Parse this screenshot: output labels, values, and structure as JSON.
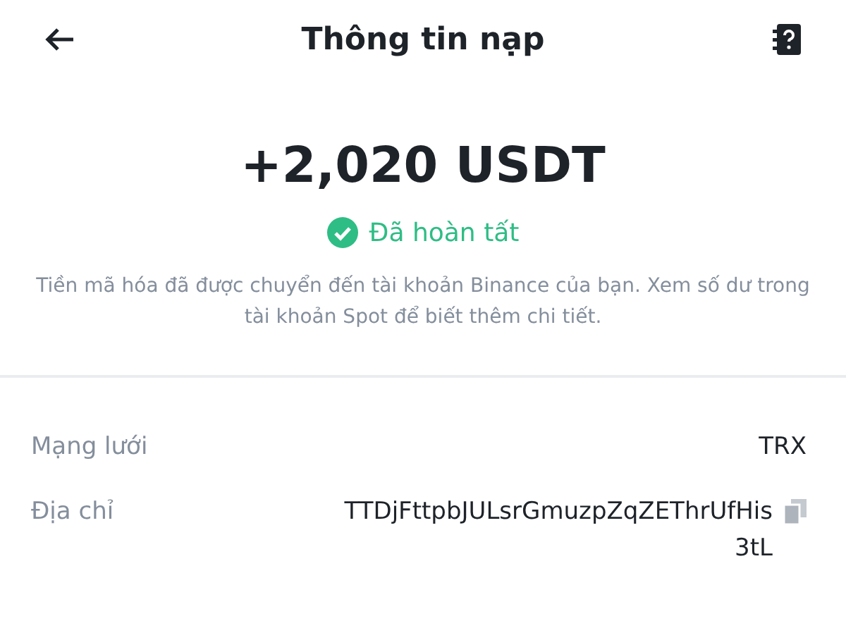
{
  "header": {
    "title": "Thông tin nạp"
  },
  "amount": "+2,020 USDT",
  "status": {
    "label": "Đã hoàn tất",
    "color": "#2ebd85"
  },
  "description": "Tiền mã hóa đã được chuyển đến tài khoản Binance của bạn. Xem số dư trong tài khoản Spot để biết thêm chi tiết.",
  "details": [
    {
      "kind": "plain",
      "label": "Mạng lưới",
      "value": "TRX"
    },
    {
      "kind": "copy",
      "label": "Địa chỉ",
      "value": "TTDjFttpbJULsrGmuzpZqZEThrUfHis3tL"
    }
  ]
}
